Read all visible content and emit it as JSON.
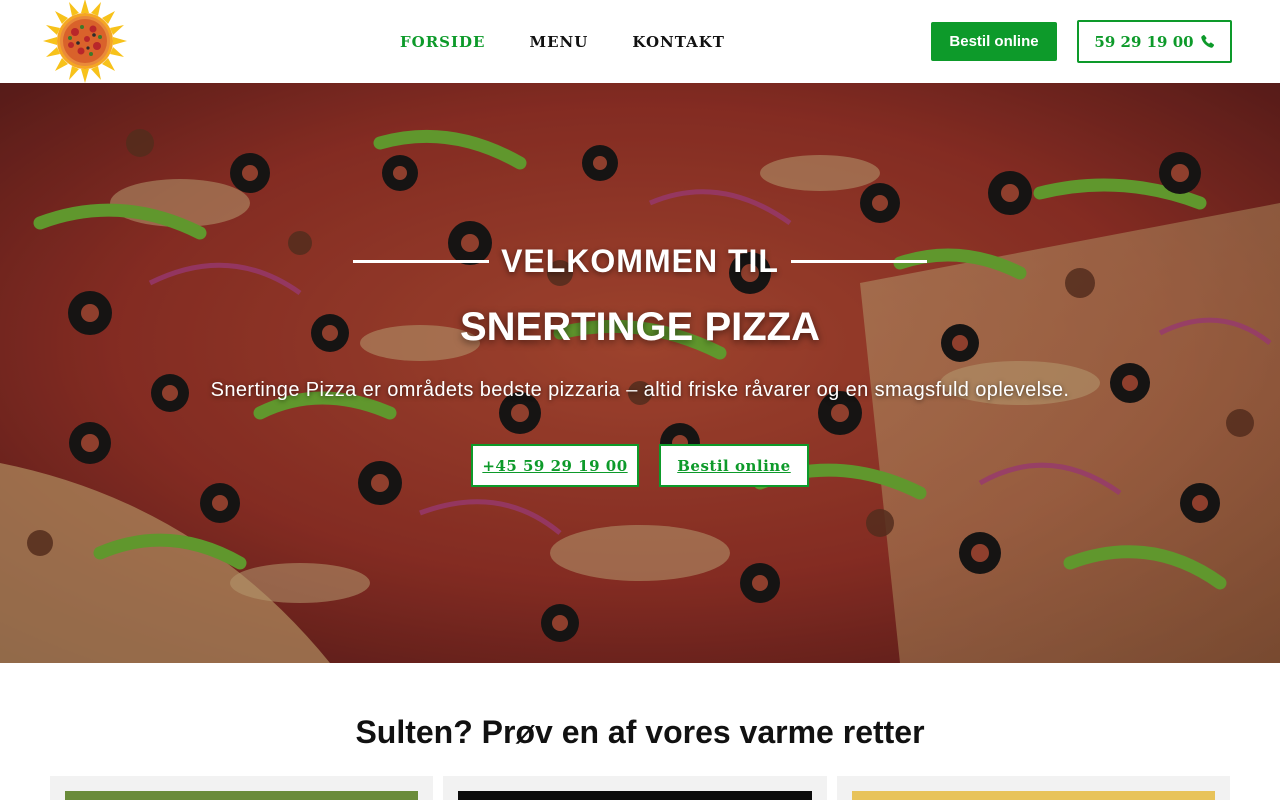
{
  "header": {
    "logo_icon": "sun-pizza-logo-icon",
    "nav": [
      {
        "label": "FORSIDE",
        "active": true
      },
      {
        "label": "MENU",
        "active": false
      },
      {
        "label": "KONTAKT",
        "active": false
      }
    ],
    "order_button": "Bestil online",
    "phone_button": "59 29 19 00",
    "phone_icon": "phone-icon"
  },
  "hero": {
    "kicker": "VELKOMMEN TIL",
    "title": "SNERTINGE PIZZA",
    "subtitle": "Snertinge Pizza er områdets bedste pizzaria – altid friske råvarer og en smagsfuld oplevelse.",
    "phone_button": "+45 59 29 19 00",
    "order_button": "Bestil online"
  },
  "dishes": {
    "title": "Sulten? Prøv en af vores varme retter"
  },
  "colors": {
    "accent": "#0d9a2a",
    "text": "#111111",
    "card_bg": "#f2f2f2"
  }
}
